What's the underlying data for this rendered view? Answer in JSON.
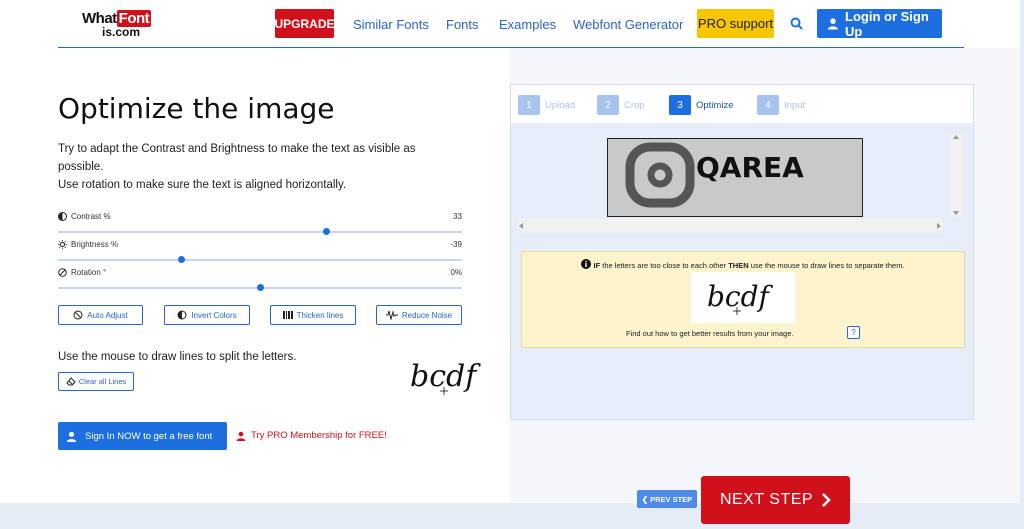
{
  "header": {
    "logo_text_1": "What",
    "logo_text_highlight": "Font",
    "logo_text_2": "is.com",
    "upgrade": "UPGRADE",
    "nav": [
      "Similar Fonts",
      "Fonts",
      "Examples",
      "Webfont Generator"
    ],
    "pro_support": "PRO support",
    "login": "Login or Sign Up"
  },
  "left": {
    "title": "Optimize the image",
    "desc_1": "Try to adapt the Contrast and Brightness to make the text as visible as possible.",
    "desc_2": "Use rotation to make sure the text is aligned horizontally.",
    "sliders": [
      {
        "label": "Contrast %",
        "value": "33",
        "position": 0.665
      },
      {
        "label": "Brightness %",
        "value": "-39",
        "position": 0.305
      },
      {
        "label": "Rotation °",
        "value": "0%",
        "position": 0.5
      }
    ],
    "tools": [
      "Auto Adjust",
      "Invert Colors",
      "Thicken lines",
      "Reduce Noise"
    ],
    "draw_hint": "Use the mouse to draw lines to split the letters.",
    "clear_lines": "Clear all Lines",
    "sample_text": "bcdf",
    "signin": "Sign In NOW to get a free font",
    "pro_trial": "Try PRO Membership for FREE!"
  },
  "right": {
    "steps": [
      {
        "num": "1",
        "label": "Upload"
      },
      {
        "num": "2",
        "label": "Crop"
      },
      {
        "num": "3",
        "label": "Optimize"
      },
      {
        "num": "4",
        "label": "Input"
      }
    ],
    "preview_text": "QAREA",
    "tip_bold_1": "IF",
    "tip_text_1": "the letters are too close to each other",
    "tip_bold_2": "THEN",
    "tip_text_2": "use the mouse to draw lines to separate them.",
    "tip_sample": "bcdf",
    "tip_find": "Find out how to get better results from your image.",
    "help": "?"
  },
  "footer": {
    "prev": "PREV STEP",
    "next": "NEXT STEP"
  },
  "colors": {
    "brand_red": "#d0111b",
    "brand_blue": "#1d6fe0",
    "pro_yellow": "#f7c600"
  }
}
